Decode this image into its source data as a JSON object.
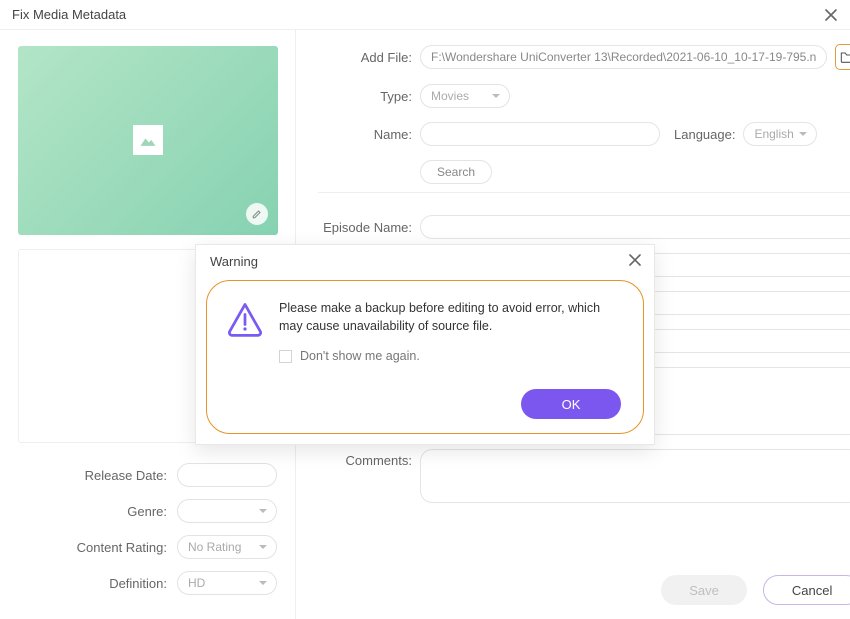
{
  "window": {
    "title": "Fix Media Metadata"
  },
  "left_form": {
    "release_date_label": "Release Date:",
    "genre_label": "Genre:",
    "content_rating_label": "Content Rating:",
    "content_rating_value": "No Rating",
    "definition_label": "Definition:",
    "definition_value": "HD"
  },
  "right_form": {
    "add_file_label": "Add File:",
    "add_file_path": "F:\\Wondershare UniConverter 13\\Recorded\\2021-06-10_10-17-19-795.n",
    "type_label": "Type:",
    "type_value": "Movies",
    "name_label": "Name:",
    "language_label": "Language:",
    "language_value": "English",
    "search_label": "Search",
    "episode_name_label": "Episode Name:",
    "comments_label": "Comments:"
  },
  "buttons": {
    "save": "Save",
    "cancel": "Cancel"
  },
  "modal": {
    "title": "Warning",
    "message": "Please make a backup before editing to avoid error, which may cause unavailability of source file.",
    "checkbox_label": "Don't show me again.",
    "ok": "OK"
  }
}
